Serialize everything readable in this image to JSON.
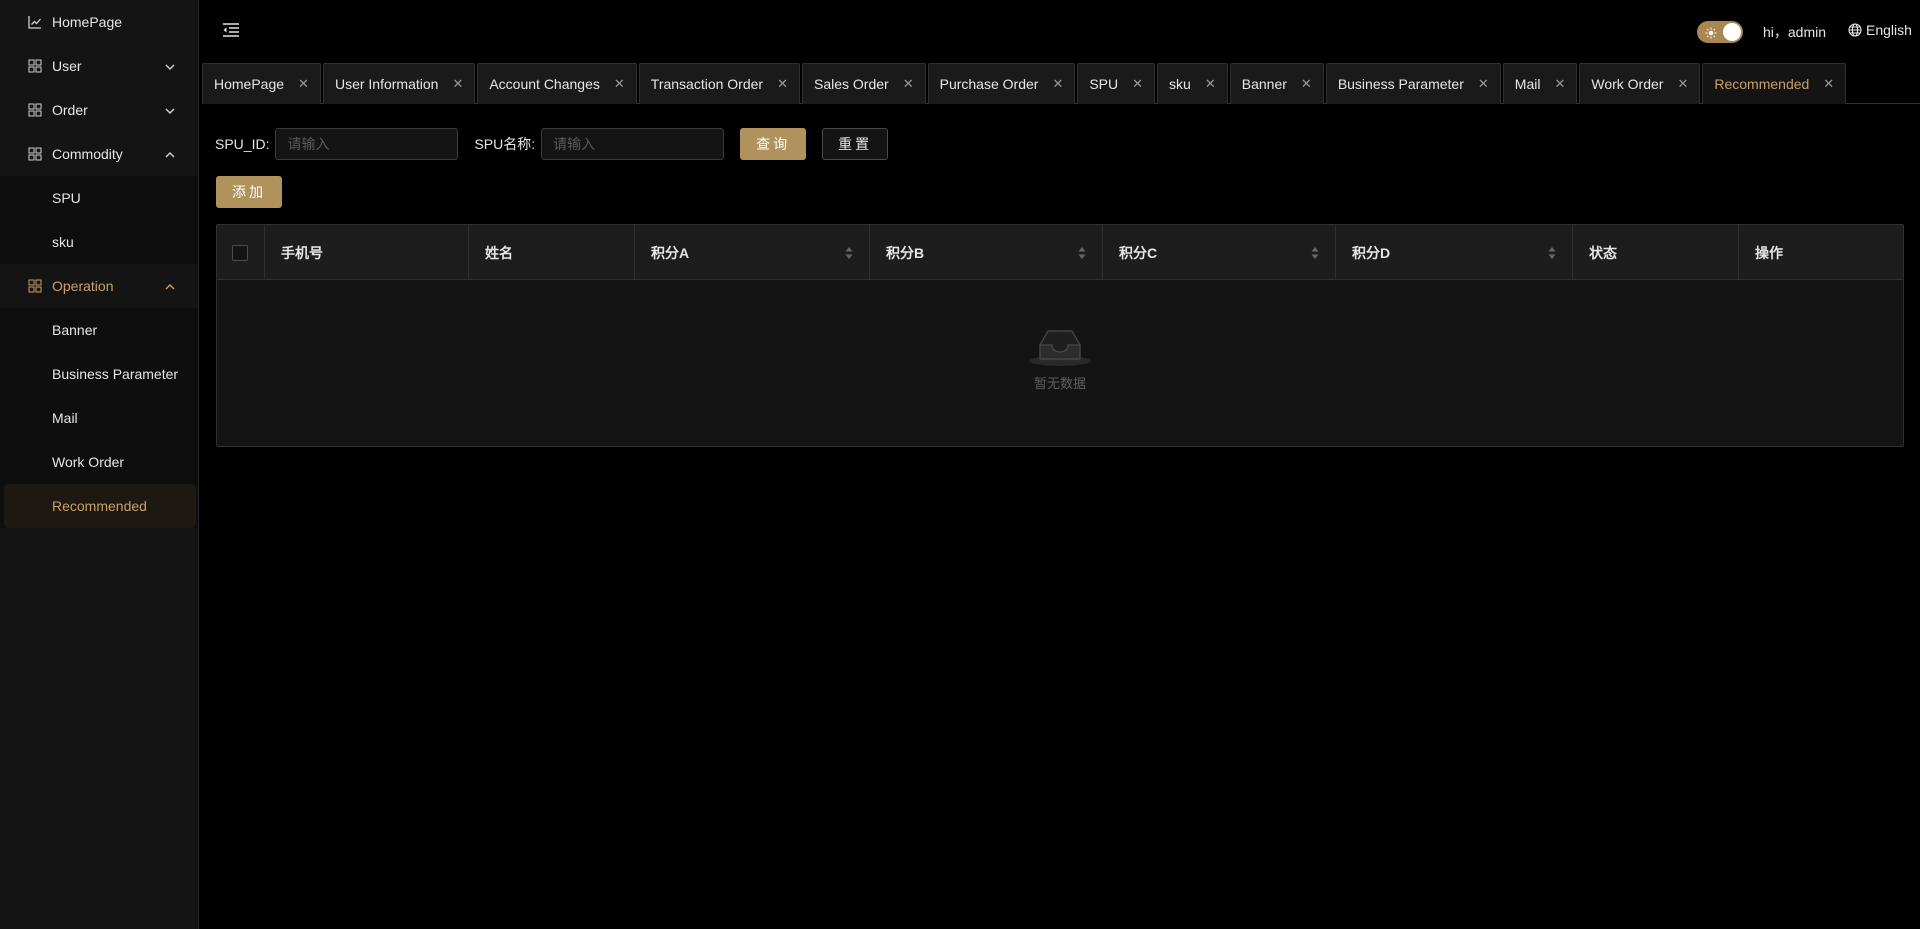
{
  "sidebar": {
    "items": [
      {
        "label": "HomePage",
        "icon": "line-chart-icon"
      },
      {
        "label": "User",
        "icon": "grid-icon"
      },
      {
        "label": "Order",
        "icon": "grid-icon"
      },
      {
        "label": "Commodity",
        "icon": "grid-icon",
        "children": [
          {
            "label": "SPU"
          },
          {
            "label": "sku"
          }
        ]
      },
      {
        "label": "Operation",
        "icon": "grid-icon",
        "children": [
          {
            "label": "Banner"
          },
          {
            "label": "Business Parameter"
          },
          {
            "label": "Mail"
          },
          {
            "label": "Work Order"
          },
          {
            "label": "Recommended"
          }
        ]
      }
    ]
  },
  "header": {
    "greeting": "hi，admin",
    "language": "English"
  },
  "tabs": [
    {
      "label": "HomePage"
    },
    {
      "label": "User Information"
    },
    {
      "label": "Account Changes"
    },
    {
      "label": "Transaction Order"
    },
    {
      "label": "Sales Order"
    },
    {
      "label": "Purchase Order"
    },
    {
      "label": "SPU"
    },
    {
      "label": "sku"
    },
    {
      "label": "Banner"
    },
    {
      "label": "Business Parameter"
    },
    {
      "label": "Mail"
    },
    {
      "label": "Work Order"
    },
    {
      "label": "Recommended"
    }
  ],
  "search": {
    "spu_id_label": "SPU_ID:",
    "spu_id_placeholder": "请输入",
    "spu_name_label": "SPU名称:",
    "spu_name_placeholder": "请输入",
    "query_label": "查询",
    "reset_label": "重置"
  },
  "actions": {
    "add_label": "添加"
  },
  "table": {
    "columns": [
      "手机号",
      "姓名",
      "积分A",
      "积分B",
      "积分C",
      "积分D",
      "状态",
      "操作"
    ],
    "empty_text": "暂无数据"
  },
  "colors": {
    "accent": "#c9a063",
    "primary_button": "#b0925c",
    "background": "#000000",
    "sidebar": "#141414"
  }
}
